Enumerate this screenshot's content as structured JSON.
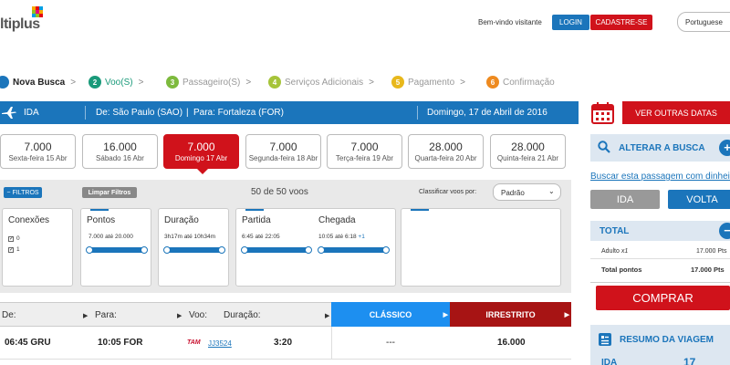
{
  "header": {
    "logo_text": "ltiplus",
    "welcome": "Bem-vindo visitante",
    "login": "LOGIN",
    "signup": "CADASTRE-SE",
    "language": "Portuguese"
  },
  "steps": [
    {
      "num": "",
      "label": "Nova Busca"
    },
    {
      "num": "2",
      "label": "Voo(S)"
    },
    {
      "num": "3",
      "label": "Passageiro(S)"
    },
    {
      "num": "4",
      "label": "Serviços Adicionais"
    },
    {
      "num": "5",
      "label": "Pagamento"
    },
    {
      "num": "6",
      "label": "Confirmação"
    }
  ],
  "trip": {
    "type": "IDA",
    "from": "De: São Paulo (SAO)",
    "to": "Para: Fortaleza (FOR)",
    "date": "Domingo, 17 de Abril de 2016"
  },
  "dates": [
    {
      "points": "7.000",
      "day": "Sexta-feira 15 Abr"
    },
    {
      "points": "16.000",
      "day": "Sábado 16 Abr"
    },
    {
      "points": "7.000",
      "day": "Domingo 17 Abr"
    },
    {
      "points": "7.000",
      "day": "Segunda-feira 18 Abr"
    },
    {
      "points": "7.000",
      "day": "Terça-feira 19 Abr"
    },
    {
      "points": "28.000",
      "day": "Quarta-feira 20 Abr"
    },
    {
      "points": "28.000",
      "day": "Quinta-feira 21 Abr"
    }
  ],
  "filters": {
    "filtros": "FILTROS",
    "limpar": "Limpar Filtros",
    "count": "50 de 50 voos",
    "sort_label": "Classificar voos por:",
    "sort_value": "Padrão",
    "conexoes": {
      "title": "Conexões",
      "opt0": "0",
      "opt1": "1"
    },
    "pontos": {
      "title": "Pontos",
      "min": "7.000",
      "ate": "até",
      "max": "20.000"
    },
    "duracao": {
      "title": "Duração",
      "min": "3h17m",
      "ate": "até",
      "max": "10h34m"
    },
    "partida": {
      "title": "Partida",
      "min": "6:45",
      "ate": "até",
      "max": "22:05"
    },
    "chegada": {
      "title": "Chegada",
      "min": "10:05",
      "ate": "até",
      "max": "6:18",
      "plus": "+1"
    }
  },
  "results": {
    "col_de": "De:",
    "col_para": "Para:",
    "col_voo": "Voo:",
    "col_duracao": "Duração:",
    "classico": "CLÁSSICO",
    "irrestrito": "IRRESTRITO",
    "row": {
      "dep": "06:45 GRU",
      "arr": "10:05 FOR",
      "airline": "TAM",
      "flight": "JJ3524",
      "duration": "3:20",
      "classico": "---",
      "irrestrito": "16.000"
    }
  },
  "sidebar": {
    "other_dates": "VER OUTRAS DATAS",
    "alterar": "ALTERAR A BUSCA",
    "busca_link": "Buscar esta passagem com dinheiro",
    "ida": "IDA",
    "volta": "VOLTA",
    "total": "TOTAL",
    "adulto_label": "Adulto",
    "adulto_qty": "x1",
    "adulto_pts": "17.000 Pts",
    "total_label": "Total pontos",
    "total_pts": "17.000 Pts",
    "comprar": "COMPRAR",
    "resumo": "RESUMO DA VIAGEM",
    "resumo_ida": "IDA",
    "resumo_val": "17"
  },
  "colors": {
    "primary_blue": "#1b75bb",
    "brand_red": "#d0121b",
    "classico_blue": "#1d8ff0",
    "irrestrito_red": "#a71414"
  }
}
